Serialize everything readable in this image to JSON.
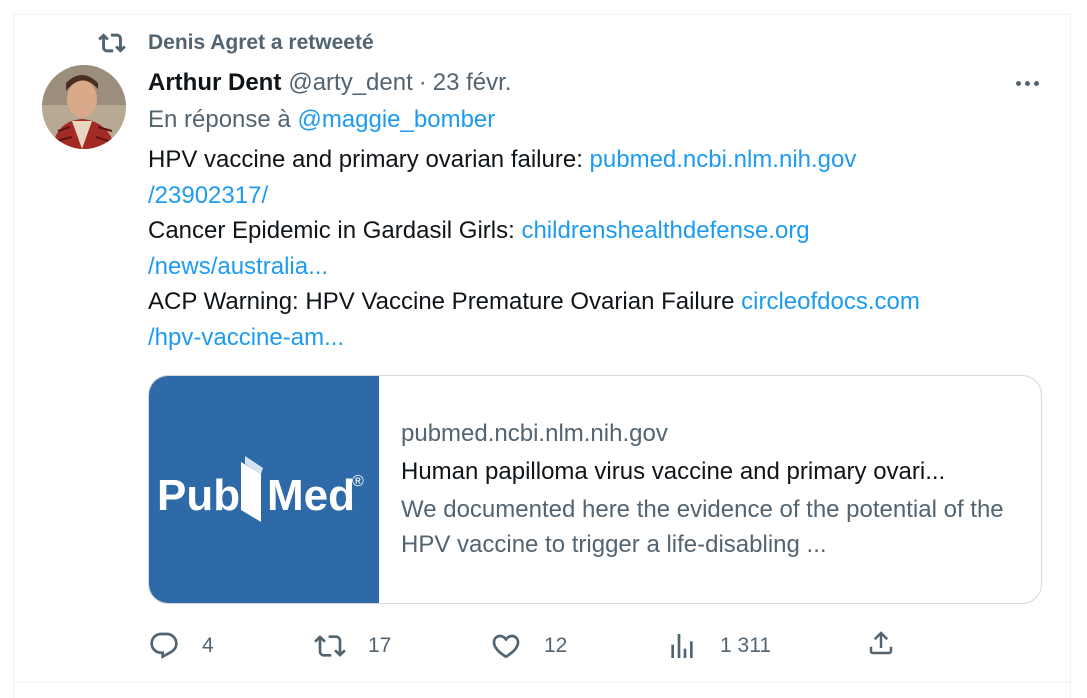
{
  "retweet": {
    "icon": "retweet-icon",
    "text": "Denis Agret a retweeté"
  },
  "tweet": {
    "author": {
      "display_name": "Arthur Dent",
      "handle": "@arty_dent",
      "separator": "·",
      "date": "23 févr.",
      "avatar_icon": "avatar"
    },
    "reply": {
      "prefix": "En réponse à",
      "mention": "@maggie_bomber"
    },
    "lines": [
      {
        "text": "HPV vaccine and primary ovarian failure: ",
        "link": "pubmed.ncbi.nlm.nih.gov"
      },
      {
        "text": "",
        "link": "/23902317/"
      },
      {
        "text": "Cancer Epidemic in Gardasil Girls: ",
        "link": "childrenshealthdefense.org"
      },
      {
        "text": "",
        "link": "/news/australia..."
      },
      {
        "text": "ACP Warning: HPV Vaccine Premature Ovarian Failure ",
        "link": "circleofdocs.com"
      },
      {
        "text": "",
        "link": "/hpv-vaccine-am..."
      }
    ],
    "card": {
      "logo_text_left": "Pub",
      "logo_text_right": "Med",
      "logo_mark": "®",
      "domain": "pubmed.ncbi.nlm.nih.gov",
      "title": "Human papilloma virus vaccine and primary ovari...",
      "description": "We documented here the evidence of the potential of the HPV vaccine to trigger a life-disabling ..."
    },
    "actions": {
      "reply_count": "4",
      "retweet_count": "17",
      "like_count": "12",
      "views_count": "1 311"
    }
  },
  "colors": {
    "link": "#1d9bf0",
    "secondary_text": "#536471",
    "pubmed_blue": "#2e6aa7"
  }
}
